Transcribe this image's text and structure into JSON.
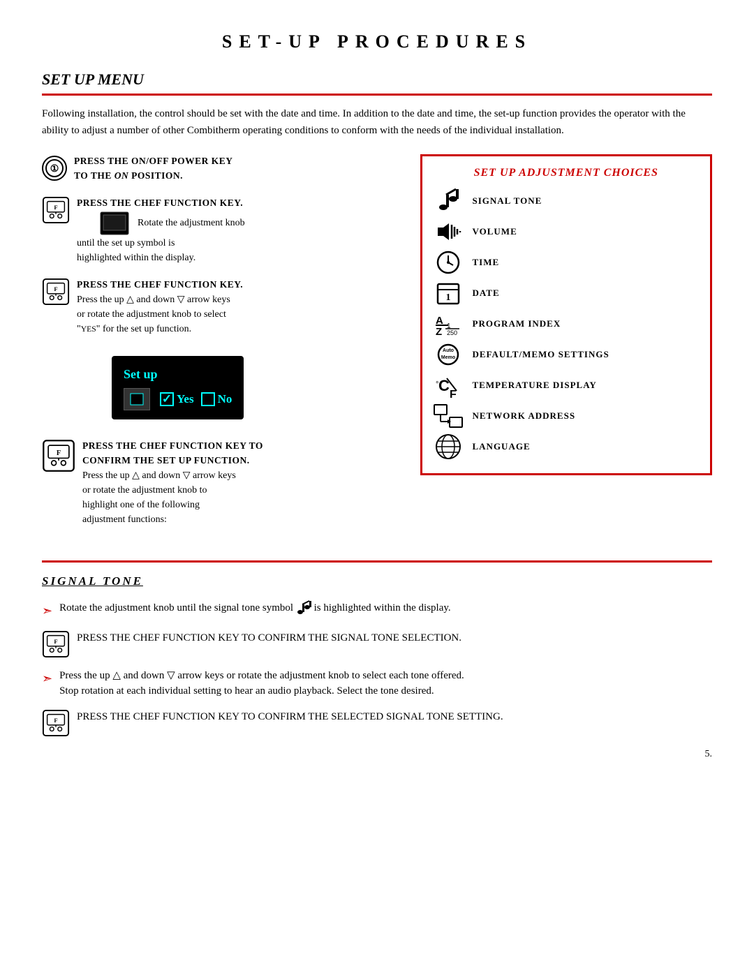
{
  "page": {
    "main_title": "SET-UP PROCEDURES",
    "section1": {
      "title": "SET UP MENU",
      "intro": "Following installation, the control should be set with the date and time. In addition to the date and time, the set-up function provides the operator with the ability to adjust a number of other Combitherm operating conditions to conform with the needs of the individual installation."
    },
    "steps": [
      {
        "instruction": "PRESS THE ON/OFF POWER KEY TO THE ON POSITION.",
        "italic_word": "ON"
      },
      {
        "instruction": "PRESS THE CHEF FUNCTION KEY.",
        "sub": "Rotate the adjustment knob until the set up symbol is highlighted within the display."
      },
      {
        "instruction": "PRESS THE CHEF FUNCTION KEY.",
        "sub": "Press the up △ and down ▽ arrow keys or rotate the adjustment knob to select \"YES\" for the set up function."
      },
      {
        "instruction": "PRESS THE CHEF FUNCTION KEY TO CONFIRM THE SET UP FUNCTION.",
        "sub": "Press the up △ and down ▽ arrow keys or rotate the adjustment knob to highlight one of the following adjustment functions:"
      }
    ],
    "display": {
      "label": "Set up",
      "yes_label": "Yes",
      "no_label": "No"
    },
    "adjustment_box": {
      "title": "SET UP ADJUSTMENT CHOICES",
      "items": [
        {
          "label": "SIGNAL TONE",
          "icon": "music-note"
        },
        {
          "label": "VOLUME",
          "icon": "volume"
        },
        {
          "label": "TIME",
          "icon": "clock"
        },
        {
          "label": "DATE",
          "icon": "calendar"
        },
        {
          "label": "PROGRAM INDEX",
          "icon": "program-index"
        },
        {
          "label": "DEFAULT/MEMO SETTINGS",
          "icon": "memo"
        },
        {
          "label": "TEMPERATURE DISPLAY",
          "icon": "temp"
        },
        {
          "label": "NETWORK ADDRESS",
          "icon": "network"
        },
        {
          "label": "LANGUAGE",
          "icon": "globe"
        }
      ]
    },
    "signal_tone_section": {
      "title": "SIGNAL TONE",
      "steps": [
        {
          "type": "arrow",
          "text": "Rotate the adjustment knob until the signal tone symbol",
          "text2": "is highlighted within the display."
        },
        {
          "type": "chef",
          "text": "PRESS THE CHEF FUNCTION KEY TO CONFIRM THE SIGNAL TONE SELECTION."
        },
        {
          "type": "arrow",
          "text": "Press the up △ and down ▽ arrow keys or rotate the adjustment knob to select each tone offered. Stop rotation at each individual setting to hear an audio playback. Select the tone desired."
        },
        {
          "type": "chef",
          "text": "PRESS THE CHEF FUNCTION KEY TO CONFIRM THE SELECTED SIGNAL TONE SETTING."
        }
      ]
    },
    "page_number": "5."
  }
}
